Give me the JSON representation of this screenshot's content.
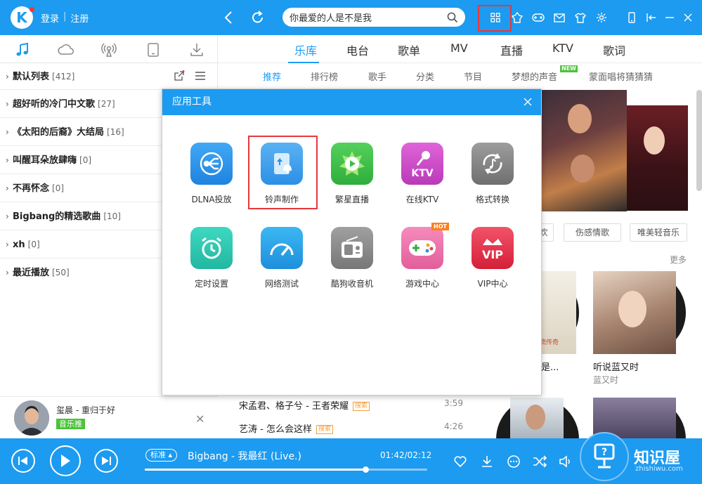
{
  "header": {
    "login": "登录",
    "register": "注册",
    "search_value": "你最爱的人是不是我",
    "icons": [
      "apps-grid-icon",
      "skin-icon",
      "game-icon",
      "mail-icon",
      "shirt-icon",
      "settings-icon",
      "mobile-icon",
      "minimize-to-tray-icon",
      "minimize-icon",
      "close-icon"
    ]
  },
  "sidebar": {
    "tabs": [
      "music-note-icon",
      "cloud-icon",
      "radio-icon",
      "device-icon",
      "download-icon"
    ],
    "playlists": [
      {
        "name": "默认列表",
        "count": "[412]"
      },
      {
        "name": "超好听的冷门中文歌",
        "count": "[27]"
      },
      {
        "name": "《太阳的后裔》大结局",
        "count": "[16]"
      },
      {
        "name": "叫醒耳朵放肆嗨",
        "count": "[0]"
      },
      {
        "name": "不再怀念",
        "count": "[0]"
      },
      {
        "name": "Bigbang的精选歌曲",
        "count": "[10]"
      },
      {
        "name": "xh",
        "count": "[0]"
      },
      {
        "name": "最近播放",
        "count": "[50]"
      }
    ],
    "now_card": {
      "title": "玺晨 - 重归于好",
      "tag": "音乐推"
    }
  },
  "main": {
    "tabs": [
      "乐库",
      "电台",
      "歌单",
      "MV",
      "直播",
      "KTV",
      "歌词"
    ],
    "subtabs": [
      "推荐",
      "排行榜",
      "歌手",
      "分类",
      "节目",
      "梦想的声音",
      "蒙面唱将猜猜猜"
    ],
    "new_badge": "NEW",
    "tag_buttons": [
      "欢",
      "伤感情歌",
      "唯美轻音乐"
    ],
    "more": "更多",
    "albums": [
      {
        "title": "是...",
        "sub": "",
        "cover_text": "流传奇"
      },
      {
        "title": "听说蓝又时",
        "sub": "蓝又时"
      }
    ],
    "songs": [
      {
        "title": "宋孟君、格子兮 - 王者荣耀",
        "src": "搜索",
        "time": "3:59"
      },
      {
        "title": "艺涛 - 怎么会这样",
        "src": "搜索",
        "time": "4:26"
      }
    ]
  },
  "dialog": {
    "title": "应用工具",
    "tools": [
      {
        "label": "DLNA投放",
        "icon": "dlna-icon",
        "color": "#2f8fe8"
      },
      {
        "label": "铃声制作",
        "icon": "ringtone-icon",
        "color": "#3a9ae8"
      },
      {
        "label": "繁星直播",
        "icon": "live-stream-icon",
        "color": "#3cbf4a"
      },
      {
        "label": "在线KTV",
        "icon": "ktv-icon",
        "color": "#d048c9",
        "icon_text": "KTV"
      },
      {
        "label": "格式转换",
        "icon": "format-convert-icon",
        "color": "#8a8a8a"
      },
      {
        "label": "定时设置",
        "icon": "alarm-clock-icon",
        "color": "#2cc7b0"
      },
      {
        "label": "网络测试",
        "icon": "speedometer-icon",
        "color": "#2aa3e6"
      },
      {
        "label": "酷狗收音机",
        "icon": "radio-set-icon",
        "color": "#8e8e8e"
      },
      {
        "label": "游戏中心",
        "icon": "gamepad-icon",
        "color": "#f07ab0",
        "badge": "HOT"
      },
      {
        "label": "VIP中心",
        "icon": "vip-crown-icon",
        "color": "#e9324b",
        "icon_text": "VIP"
      }
    ]
  },
  "player": {
    "quality": "标准",
    "title": "Bigbang - 我最红 (Live.)",
    "time": "01:42/02:12",
    "progress": 0.78
  },
  "watermark": {
    "text": "知识屋",
    "sub": "zhishiwu.com"
  }
}
